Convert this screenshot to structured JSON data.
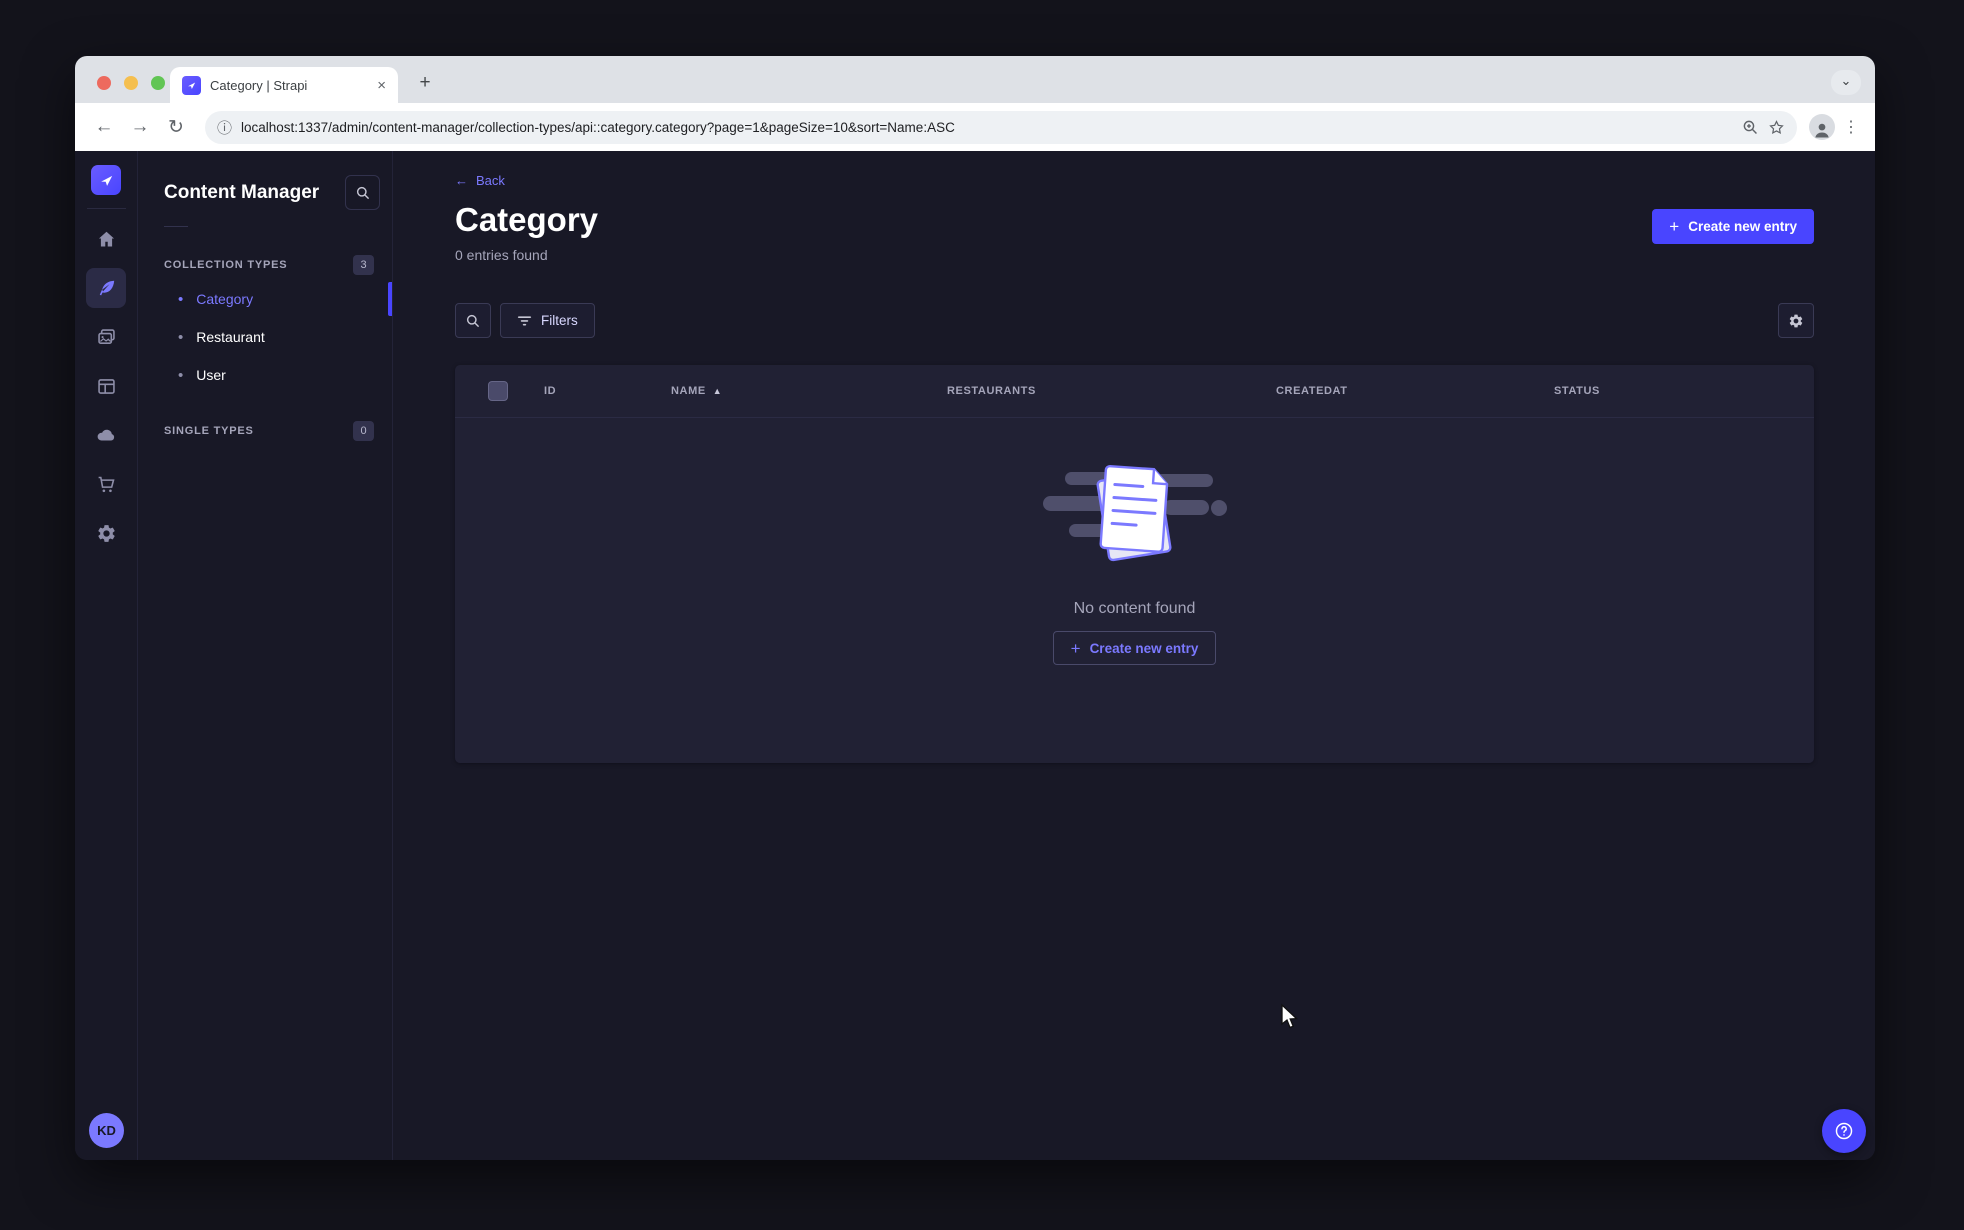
{
  "browser": {
    "tab_title": "Category | Strapi",
    "url": "localhost:1337/admin/content-manager/collection-types/api::category.category?page=1&pageSize=10&sort=Name:ASC"
  },
  "glyphs": {
    "back_arrow": "←",
    "forward_arrow": "→",
    "reload": "↻",
    "info": "ⓘ",
    "plus": "+",
    "close": "×",
    "kebab": "⋮",
    "chevron_down": "⌄",
    "bullet": "•",
    "sort_asc": "▲"
  },
  "rail": {
    "avatar_initials": "KD"
  },
  "subnav": {
    "title": "Content Manager",
    "sections": [
      {
        "label": "COLLECTION TYPES",
        "badge": "3",
        "items": [
          {
            "label": "Category",
            "active": true
          },
          {
            "label": "Restaurant",
            "active": false
          },
          {
            "label": "User",
            "active": false
          }
        ]
      },
      {
        "label": "SINGLE TYPES",
        "badge": "0",
        "items": []
      }
    ]
  },
  "main": {
    "back_label": "Back",
    "title": "Category",
    "subtitle": "0 entries found",
    "create_button_label": "Create new entry",
    "filters_button_label": "Filters",
    "table": {
      "headers": {
        "id": "ID",
        "name": "NAME",
        "restaurants": "RESTAURANTS",
        "createdat": "CREATEDAT",
        "status": "STATUS"
      }
    },
    "empty_state": {
      "message": "No content found",
      "create_button_label": "Create new entry"
    }
  },
  "colors": {
    "primary": "#4945ff",
    "primary_light": "#7b79ff",
    "surface": "#212134",
    "background": "#181826",
    "muted_text": "#a5a5ba"
  }
}
